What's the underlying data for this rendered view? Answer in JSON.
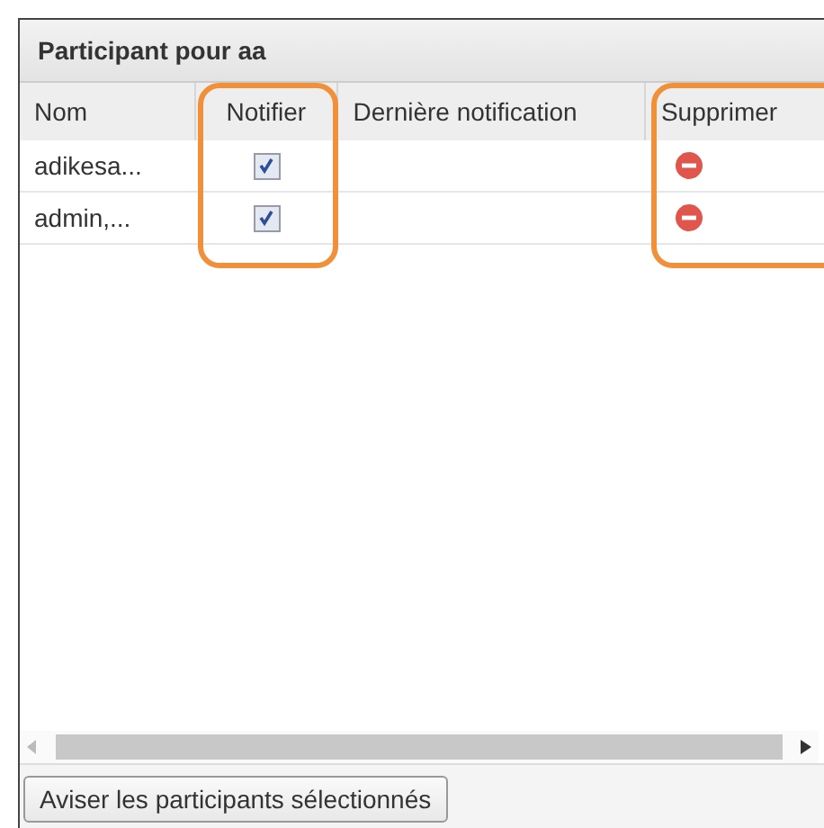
{
  "panel": {
    "title": "Participant pour aa"
  },
  "table": {
    "columns": [
      {
        "label": "Nom",
        "highlighted": false
      },
      {
        "label": "Notifier",
        "highlighted": true
      },
      {
        "label": "Dernière notification",
        "highlighted": false
      },
      {
        "label": "Supprimer",
        "highlighted": true
      }
    ],
    "rows": [
      {
        "name": "adikesa...",
        "notify_checked": true
      },
      {
        "name": "admin,...",
        "notify_checked": true
      }
    ]
  },
  "button": "Aviser les participants sélectionnés"
}
